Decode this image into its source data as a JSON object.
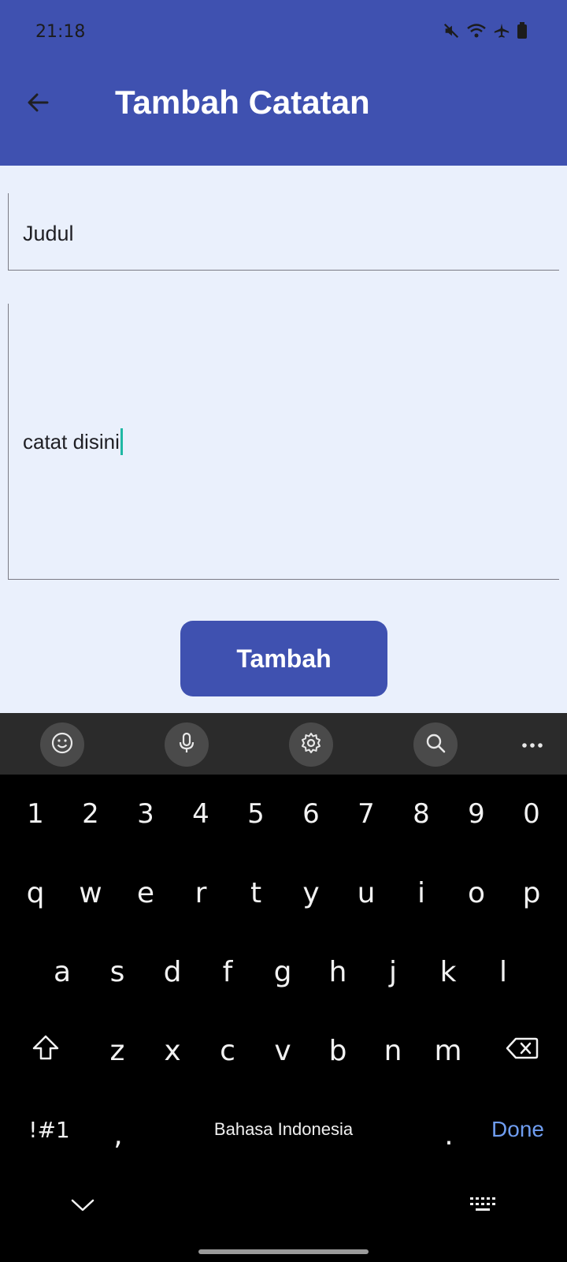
{
  "status": {
    "time": "21:18"
  },
  "appbar": {
    "title": "Tambah Catatan"
  },
  "form": {
    "title_value": "Judul",
    "note_value": "catat disini",
    "submit_label": "Tambah"
  },
  "keyboard": {
    "toolbar": [
      "emoji-icon",
      "microphone-icon",
      "settings-icon",
      "search-icon",
      "more-icon"
    ],
    "row_numbers": [
      "1",
      "2",
      "3",
      "4",
      "5",
      "6",
      "7",
      "8",
      "9",
      "0"
    ],
    "row1": [
      "q",
      "w",
      "e",
      "r",
      "t",
      "y",
      "u",
      "i",
      "o",
      "p"
    ],
    "row2": [
      "a",
      "s",
      "d",
      "f",
      "g",
      "h",
      "j",
      "k",
      "l"
    ],
    "row3": [
      "z",
      "x",
      "c",
      "v",
      "b",
      "n",
      "m"
    ],
    "symbols_label": "!#1",
    "comma": ",",
    "space_label": "Bahasa Indonesia",
    "period": ".",
    "done_label": "Done"
  },
  "colors": {
    "primary": "#3f51b0",
    "background": "#eaf0fc",
    "caret": "#1fb8a4",
    "done": "#6f9df0"
  }
}
